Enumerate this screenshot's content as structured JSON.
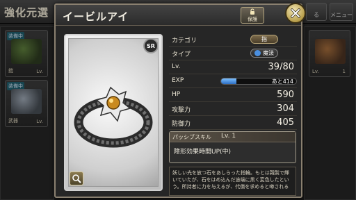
{
  "background": {
    "title": "強化元選",
    "top_buttons": [
      "る",
      "メニュー"
    ],
    "left_cards": [
      {
        "tag": "装備中",
        "label": "鎧",
        "lv": "Lv."
      },
      {
        "tag": "装備中",
        "label": "武器",
        "lv": "Lv."
      }
    ],
    "right_card": {
      "lv": "Lv.",
      "lv_value": "1"
    }
  },
  "modal": {
    "title": "イービルアイ",
    "protect_label": "保護",
    "rarity": "SR",
    "stats": {
      "category_label": "カテゴリ",
      "category_value": "指",
      "type_label": "タイプ",
      "type_value": "魔法",
      "lv_label": "Lv.",
      "lv_value": "39/80",
      "exp_label": "EXP",
      "exp_text": "あと414",
      "exp_fill_pct": 20,
      "hp_label": "HP",
      "hp_value": "590",
      "atk_label": "攻撃力",
      "atk_value": "304",
      "def_label": "防御力",
      "def_value": "405"
    },
    "skill": {
      "title": "パッシブスキル",
      "lv": "Lv. 1",
      "description": "障形効果時間UP(中)"
    },
    "flavor_text": "妖しい光を放つ石をあしらった指輪。もとは親製で輝いていたが、石をはめ込んだ途端に黒く変色したという。所持者に力を与えるが、代償を求めると噂される"
  },
  "colors": {
    "exp_fill": "#3f8fe6",
    "close_gold": "#c9ae5a",
    "frame": "#8a8070"
  },
  "icons": [
    "lock-icon",
    "close-icon",
    "zoom-icon",
    "ring-image",
    "type-orb-icon"
  ]
}
